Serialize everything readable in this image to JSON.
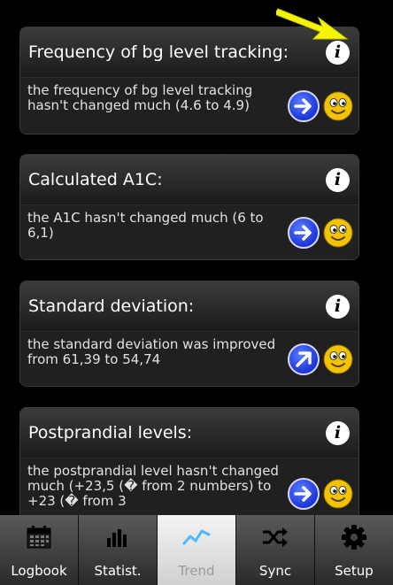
{
  "cards": [
    {
      "title": "Frequency of bg level tracking:",
      "text": "the frequency of bg level tracking hasn't changed much (4.6 to 4.9)",
      "trend": "right-arrow-icon",
      "mood": "smiley-icon"
    },
    {
      "title": "Calculated A1C:",
      "text": "the A1C hasn't changed much (6 to 6,1)",
      "trend": "right-arrow-icon",
      "mood": "smiley-icon"
    },
    {
      "title": "Standard deviation:",
      "text": "the standard deviation was improved from 61,39 to 54,74",
      "trend": "up-right-arrow-icon",
      "mood": "smiley-icon"
    },
    {
      "title": "Postprandial levels:",
      "text": "the postprandial level hasn't changed much (+23,5 (� from 2 numbers) to +23 (� from 3",
      "trend": "right-arrow-icon",
      "mood": "smiley-icon"
    }
  ],
  "info_icon": "i",
  "tabs": [
    {
      "label": "Logbook",
      "icon": "calendar-icon"
    },
    {
      "label": "Statist.",
      "icon": "bar-chart-icon"
    },
    {
      "label": "Trend",
      "icon": "trend-line-icon",
      "active": true
    },
    {
      "label": "Sync",
      "icon": "shuffle-icon"
    },
    {
      "label": "Setup",
      "icon": "gear-icon"
    }
  ],
  "colors": {
    "arrow_blue": "#1b35d8",
    "smiley_yellow": "#f2c300",
    "pointer_yellow": "#f5f500",
    "active_tab": "#e8e8e8"
  }
}
